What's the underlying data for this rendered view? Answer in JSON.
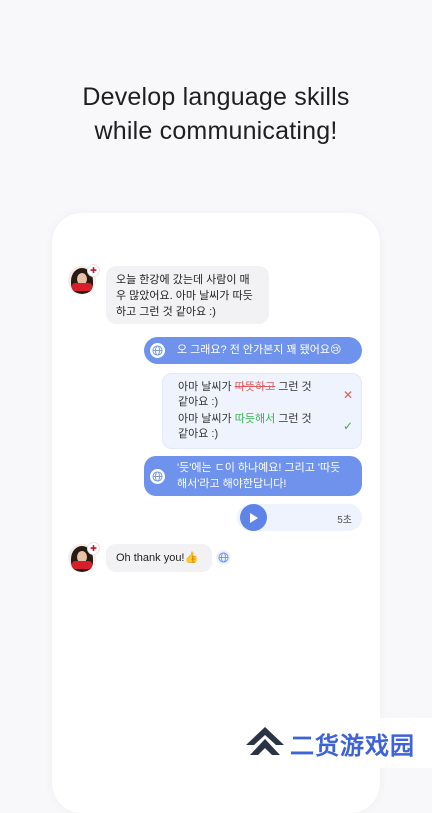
{
  "headline": {
    "line1": "Develop language skills",
    "line2": "while communicating!"
  },
  "chat": {
    "msg1": {
      "lines": [
        "오늘 한강에 갔는데 사람이 매",
        "우 많았어요. 아마 날씨가 따듯",
        "하고 그런 것 같아요 :)"
      ]
    },
    "reply1": {
      "text": "오 그래요? 전 안가본지 꽤 됐어요😢"
    },
    "correction": {
      "orig_pre": "아마 날씨가 ",
      "orig_wrong": "따뜻하고",
      "orig_post": " 그런 것",
      "orig_line2": "같아요 :)",
      "fix_pre": "아마 날씨가 ",
      "fix_right": "따듯해서",
      "fix_post": " 그런 것",
      "fix_line2": "같아요 :)"
    },
    "reply2": {
      "line1": "'듯'에는 ㄷ이 하나예요! 그리고 '따듯",
      "line2": "해서'라고 해야한답니다!"
    },
    "audio": {
      "duration": "5초"
    },
    "msg2": {
      "text": "Oh thank you!👍"
    }
  },
  "watermark": {
    "text": "二货游戏园"
  },
  "colors": {
    "accent": "#6f93ec",
    "error": "#e05b5b",
    "success": "#35b44a"
  },
  "icons": [
    "globe-icon",
    "play-icon",
    "x-icon",
    "check-icon",
    "flag-icon"
  ]
}
